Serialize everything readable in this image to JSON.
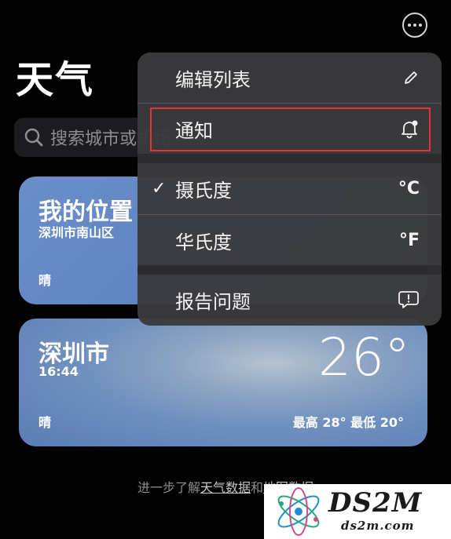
{
  "header": {
    "title": "天气"
  },
  "search": {
    "placeholder": "搜索城市或机场"
  },
  "cards": [
    {
      "city": "我的位置",
      "subtitle": "深圳市南山区",
      "condition": "晴"
    },
    {
      "city": "深圳市",
      "subtitle": "16:44",
      "condition": "晴",
      "temperature": "26°",
      "high_low": "最高 28°  最低 20°"
    }
  ],
  "footer": {
    "prefix": "进一步了解",
    "link1": "天气数据",
    "middle": "和",
    "link2": "地图数据"
  },
  "menu": {
    "edit_list": "编辑列表",
    "notifications": "通知",
    "celsius": "摄氏度",
    "celsius_unit": "°C",
    "celsius_checked": "✓",
    "fahrenheit": "华氏度",
    "fahrenheit_unit": "°F",
    "report_issue": "报告问题"
  },
  "watermark": {
    "brand": "DS2M",
    "url": "ds2m.com"
  },
  "colors": {
    "highlight_border": "#e0333a",
    "menu_bg": "#3a3a3c",
    "card_blue": "#6186c2"
  }
}
